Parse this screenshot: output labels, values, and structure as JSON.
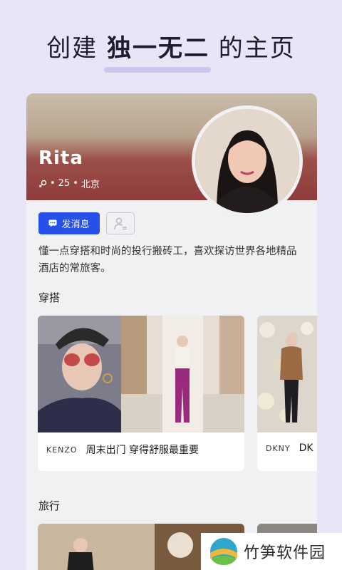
{
  "header": {
    "pre": "创建 ",
    "bold": "独一无二",
    "post": " 的主页"
  },
  "profile": {
    "name": "Rita",
    "age": "25",
    "city": "北京",
    "message_button": "发消息",
    "bio": "懂一点穿搭和时尚的投行搬砖工，喜欢探访世界各地精品酒店的常旅客。"
  },
  "sections": {
    "outfits": {
      "title": "穿搭",
      "cards": [
        {
          "brand": "KENZO",
          "title": "周末出门 穿得舒服最重要"
        },
        {
          "brand": "DKNY",
          "title": "DK"
        }
      ]
    },
    "travel": {
      "title": "旅行"
    }
  },
  "watermark": {
    "text": "竹笋软件园"
  },
  "colors": {
    "accent": "#2650e9",
    "background": "#e9e4f6"
  }
}
